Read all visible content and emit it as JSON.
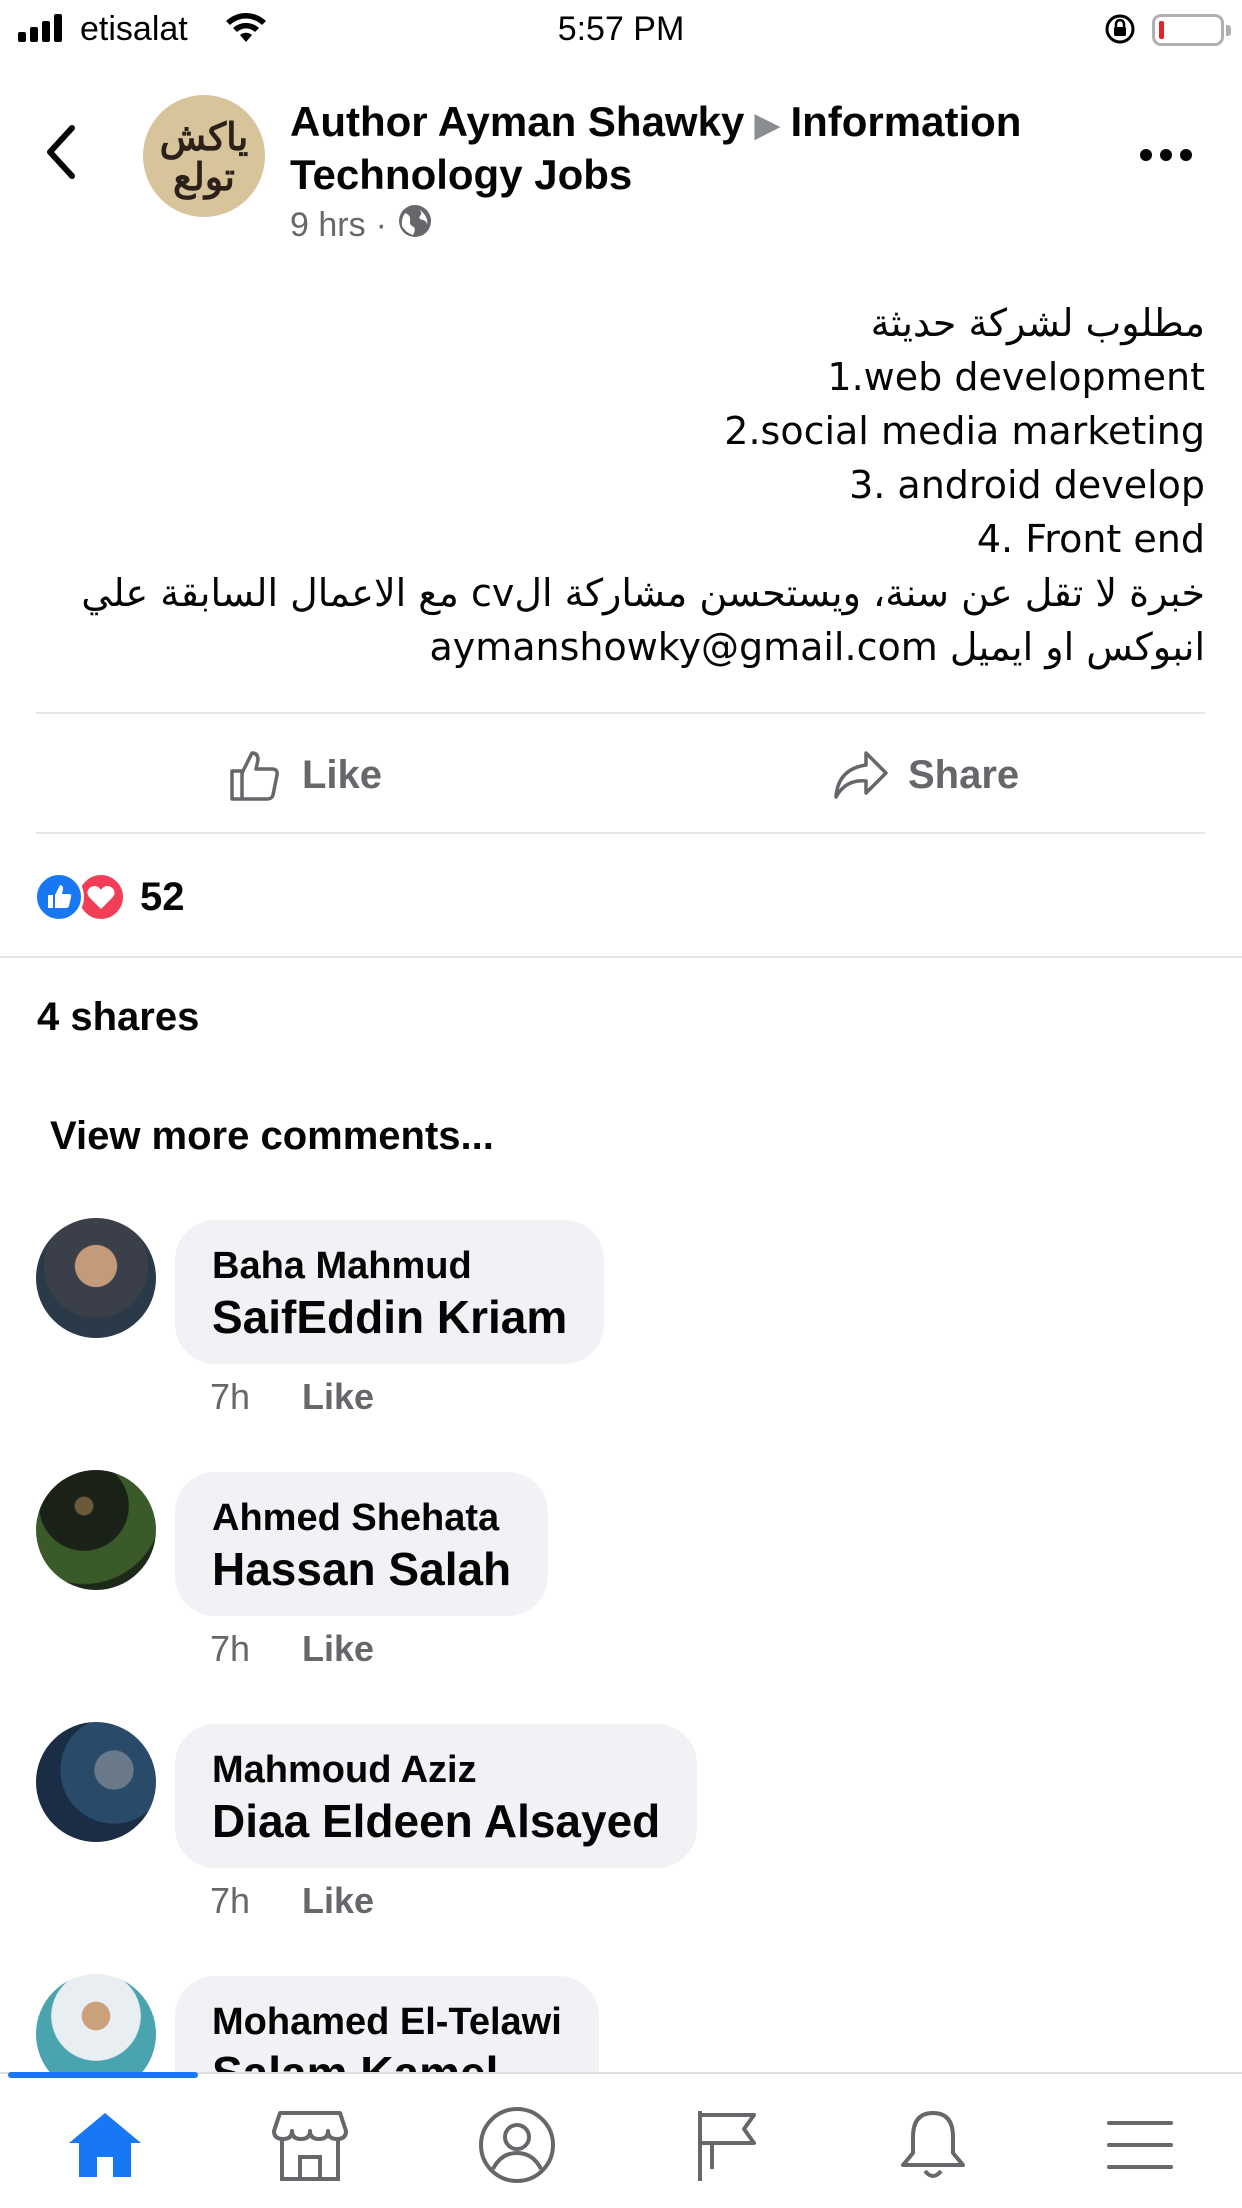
{
  "status_bar": {
    "carrier": "etisalat",
    "time": "5:57 PM"
  },
  "post": {
    "author": "Author Ayman Shawky",
    "group": "Information Technology Jobs",
    "time": "9 hrs",
    "separator": "·",
    "visibility_icon": "globe-icon",
    "avatar_text": "ياكش تولع",
    "body_lines": [
      "مطلوب لشركة حديثة",
      "1.web development",
      "2.social media marketing",
      "3. android develop",
      "4. Front end",
      "خبرة لا تقل عن سنة، ويستحسن مشاركة الcv مع الاعمال السابقة علي",
      "انبوكس او ايميل aymanshowky@gmail.com"
    ],
    "like_label": "Like",
    "share_label": "Share",
    "reaction_count": "52",
    "shares_text": "4 shares",
    "view_more": "View more comments..."
  },
  "comments": [
    {
      "author": "Baha Mahmud",
      "text": "SaifEddin Kriam",
      "time": "7h",
      "like": "Like"
    },
    {
      "author": "Ahmed Shehata",
      "text": "Hassan Salah",
      "time": "7h",
      "like": "Like"
    },
    {
      "author": "Mahmoud Aziz",
      "text": "Diaa Eldeen Alsayed",
      "time": "7h",
      "like": "Like"
    },
    {
      "author": "Mohamed El-Telawi",
      "text": "Salam Kamel",
      "time": "",
      "like": ""
    }
  ],
  "tabs": [
    "home-icon",
    "marketplace-icon",
    "profile-icon",
    "pages-flag-icon",
    "notifications-bell-icon",
    "menu-icon"
  ],
  "colors": {
    "accent": "#1877f2",
    "love": "#f33e58",
    "bubble": "#f0f2f5",
    "secondary_text": "#65676b",
    "battery_low": "#e0242a"
  }
}
